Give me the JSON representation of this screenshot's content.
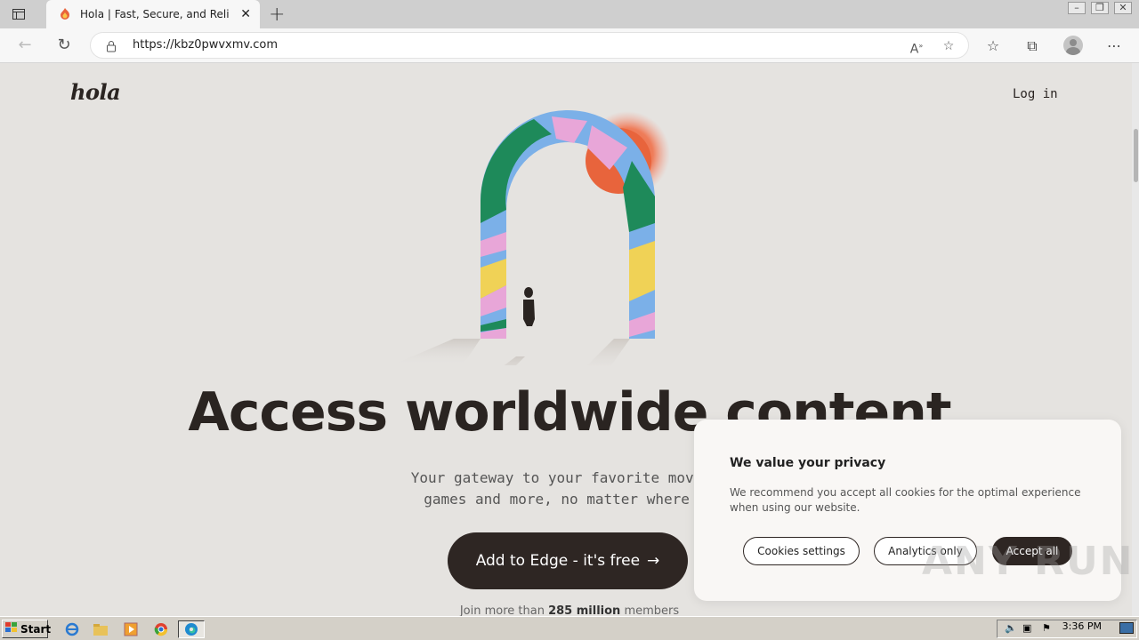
{
  "browser": {
    "tab_title": "Hola | Fast, Secure, and Reliable",
    "tab_close": "✕",
    "new_tab": "+",
    "url": "https://kbz0pwvxmv.com"
  },
  "page": {
    "logo": "hola",
    "login": "Log in",
    "headline": "Access worldwide content",
    "subtitle_line1": "Your gateway to your favorite movies,",
    "subtitle_line2": "games and more, no matter where yo",
    "cta": "Add to Edge - it's free",
    "cta_arrow": "→",
    "members_prefix": "Join more than",
    "members_count": "285 million",
    "members_suffix": "members"
  },
  "cookie": {
    "title": "We value your privacy",
    "text": "We recommend you accept all cookies for the optimal experience when using our website.",
    "settings": "Cookies settings",
    "analytics": "Analytics only",
    "accept": "Accept all"
  },
  "watermark": "ANY RUN",
  "taskbar": {
    "start": "Start",
    "time": "3:36 PM"
  }
}
